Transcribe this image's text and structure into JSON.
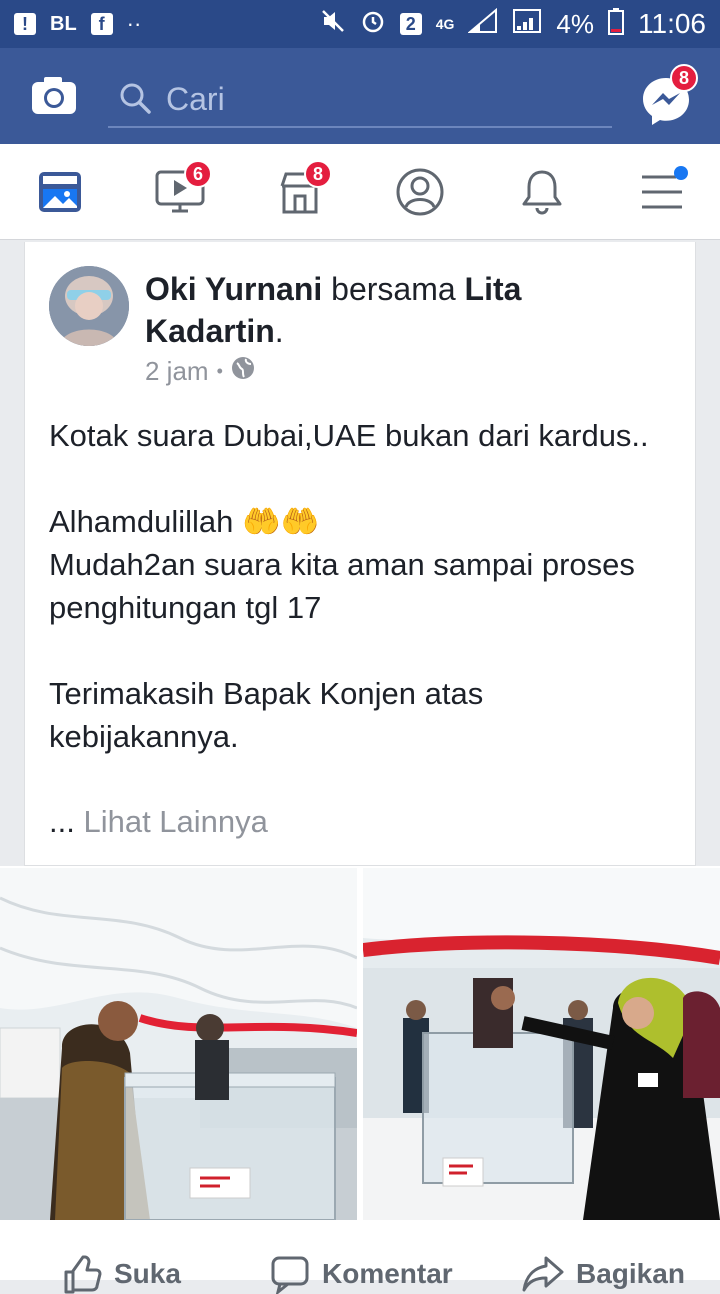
{
  "status_bar": {
    "carrier": "BL",
    "sim_badge": "2",
    "network": "4G",
    "battery": "4%",
    "time": "11:06"
  },
  "header": {
    "search_placeholder": "Cari",
    "messenger_badge": "8"
  },
  "nav": {
    "video_badge": "6",
    "marketplace_badge": "8"
  },
  "post": {
    "author": "Oki Yurnani",
    "with_word": "bersama",
    "tagged": "Lita Kadartin",
    "period": ".",
    "time": "2 jam",
    "separator": "•",
    "text": "Kotak suara Dubai,UAE bukan dari kardus..\n\nAlhamdulillah 🤲🤲\nMudah2an suara kita aman sampai proses penghitungan tgl 17\n\nTerimakasih Bapak Konjen atas kebijakannya.",
    "ellipsis": "...",
    "see_more": "Lihat Lainnya"
  },
  "actions": {
    "like": "Suka",
    "comment": "Komentar",
    "share": "Bagikan"
  },
  "colors": {
    "brand": "#3b5998",
    "status_bar": "#2a4988",
    "badge": "#e41e3f"
  }
}
